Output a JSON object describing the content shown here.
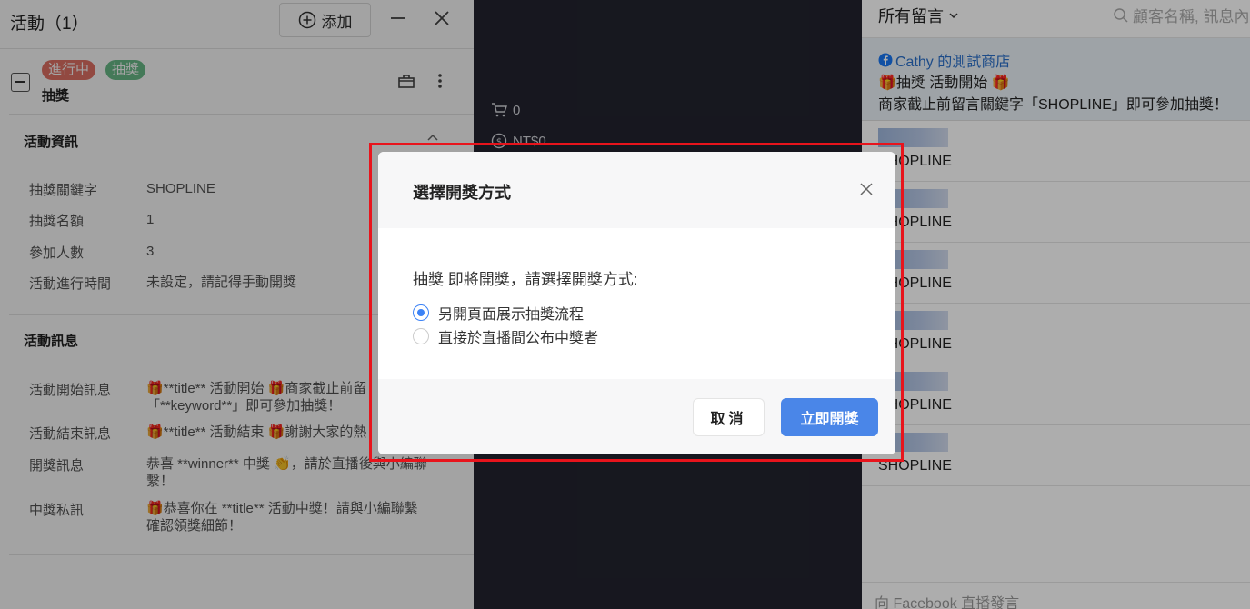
{
  "left_panel": {
    "title": "活動（1）",
    "add_label": "添加",
    "card": {
      "status_badge": "進行中",
      "type_badge": "抽獎",
      "name": "抽獎"
    },
    "info_section": {
      "title": "活動資訊",
      "rows": [
        {
          "label": "抽獎關鍵字",
          "value": "SHOPLINE"
        },
        {
          "label": "抽獎名額",
          "value": "1"
        },
        {
          "label": "參加人數",
          "value": "3"
        },
        {
          "label": "活動進行時間",
          "value": "未設定，請記得手動開獎"
        }
      ]
    },
    "message_section": {
      "title": "活動訊息",
      "rows": [
        {
          "label": "活動開始訊息",
          "line1": "🎁**title** 活動開始 🎁商家截止前留",
          "line2": "「**keyword**」即可參加抽獎！"
        },
        {
          "label": "活動結束訊息",
          "line1": "🎁**title** 活動結束 🎁謝謝大家的熱",
          "line2": ""
        },
        {
          "label": "開獎訊息",
          "line1": "恭喜 **winner** 中獎 👏，請於直播後與小編聯",
          "line2": "繫！"
        },
        {
          "label": "中獎私訊",
          "line1": "🎁恭喜你在 **title** 活動中獎！請與小編聯繫",
          "line2": "確認領獎細節！"
        }
      ]
    }
  },
  "center_panel": {
    "cart_count": "0",
    "amount": "NT$0"
  },
  "right_panel": {
    "filter_label": "所有留言",
    "search_placeholder": "顧客名稱, 訊息內",
    "pinned": {
      "shop_name": "Cathy 的測試商店",
      "line1": "🎁抽獎 活動開始 🎁",
      "line2": "商家截止前留言關鍵字「SHOPLINE」即可參加抽獎！"
    },
    "comments": [
      {
        "text": "SHOPLINE"
      },
      {
        "text": "SHOPLINE"
      },
      {
        "text": "SHOPLINE"
      },
      {
        "text": "SHOPLINE"
      },
      {
        "text": "SHOPLINE"
      },
      {
        "text": "SHOPLINE"
      }
    ],
    "footer_placeholder": "向 Facebook 直播發言"
  },
  "modal": {
    "title": "選擇開獎方式",
    "question": "抽獎 即將開獎，請選擇開獎方式:",
    "options": [
      {
        "label": "另開頁面展示抽獎流程",
        "checked": true
      },
      {
        "label": "直接於直播間公布中獎者",
        "checked": false
      }
    ],
    "cancel_label": "取消",
    "confirm_label": "立即開獎"
  },
  "colors": {
    "primary": "#4a86e8",
    "radio_active": "#3b82f6",
    "status_red": "#e57367",
    "status_green": "#6cbf8b",
    "dark_panel": "#22232e",
    "highlight": "#e8141c",
    "facebook_blue": "#1877f2"
  }
}
